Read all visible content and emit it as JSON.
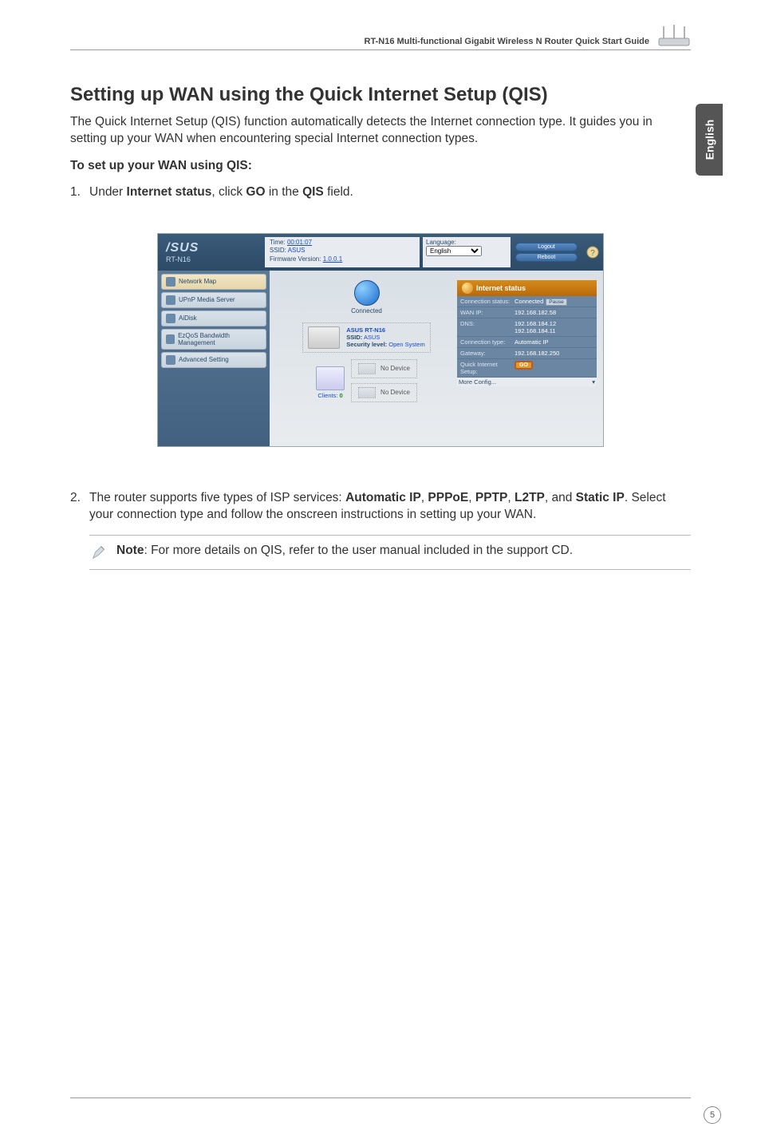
{
  "header": {
    "title": "RT-N16 Multi-functional Gigabit Wireless N Router Quick Start Guide"
  },
  "side_tab": "English",
  "section_title": "Setting up WAN using the Quick Internet Setup (QIS)",
  "intro": "The Quick Internet Setup (QIS) function automatically detects the Internet connection type. It guides you in setting up your WAN when encountering special Internet connection types.",
  "setup_heading": "To set up your WAN using QIS:",
  "step1": {
    "num": "1.",
    "pre": "Under ",
    "b1": "Internet status",
    "mid": ", click ",
    "b2": "GO",
    "mid2": " in the ",
    "b3": "QIS",
    "post": " field."
  },
  "step2": {
    "num": "2.",
    "pre": "The router supports five types of ISP services: ",
    "b1": "Automatic IP",
    "c1": ", ",
    "b2": "PPPoE",
    "c2": ", ",
    "b3": "PPTP",
    "c3": ", ",
    "b4": "L2TP",
    "c4": ", and ",
    "b5": "Static IP",
    "post": ". Select your connection type and follow the onscreen instructions in setting up your WAN."
  },
  "note": {
    "b": "Note",
    "text": ": For more details on QIS, refer to the user manual included in the support CD."
  },
  "page_num": "5",
  "screenshot": {
    "logo_main": "/SUS",
    "logo_sub": "RT-N16",
    "info": {
      "time_label": "Time:",
      "time_value": "00:01:07",
      "ssid_label": "SSID:",
      "ssid_value": "ASUS",
      "fw_label": "Firmware Version:",
      "fw_value": "1.0.0.1"
    },
    "lang_label": "Language:",
    "lang_value": "English",
    "btn_logout": "Logout",
    "btn_reboot": "Reboot",
    "sidebar": [
      "Network Map",
      "UPnP Media Server",
      "AiDisk",
      "EzQoS Bandwidth Management",
      "Advanced Setting"
    ],
    "center": {
      "connected": "Connected",
      "device_name": "ASUS RT-N16",
      "device_ssid_label": "SSID:",
      "device_ssid": "ASUS",
      "sec_label": "Security level:",
      "sec_value": "Open System",
      "clients_label": "Clients:",
      "clients_value": "0",
      "no_device": "No Device"
    },
    "status": {
      "header": "Internet status",
      "rows": [
        {
          "k": "Connection status:",
          "v": "Connected",
          "pause": "Pause"
        },
        {
          "k": "WAN IP:",
          "v": "192.168.182.58"
        },
        {
          "k": "DNS:",
          "v": "192.168.184.12 192.168.184.11"
        },
        {
          "k": "Connection type:",
          "v": "Automatic IP"
        },
        {
          "k": "Gateway:",
          "v": "192.168.182.250"
        },
        {
          "k": "Quick Internet Setup:",
          "v": "",
          "go": "GO"
        }
      ],
      "more": "More Config..."
    }
  }
}
